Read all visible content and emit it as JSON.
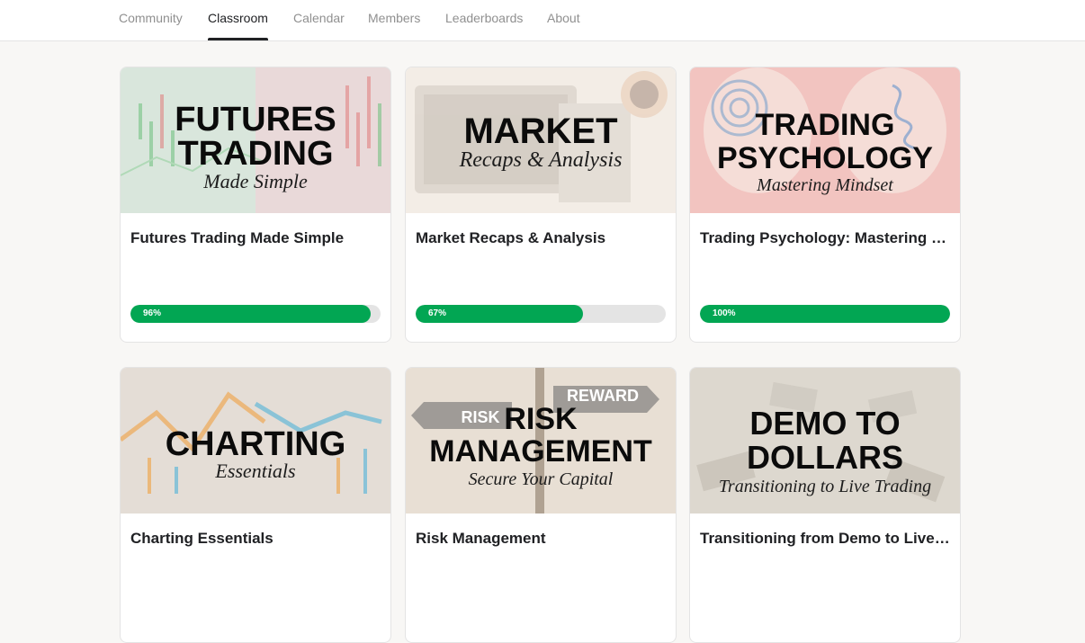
{
  "nav": {
    "tabs": [
      {
        "label": "Community"
      },
      {
        "label": "Classroom"
      },
      {
        "label": "Calendar"
      },
      {
        "label": "Members"
      },
      {
        "label": "Leaderboards"
      },
      {
        "label": "About"
      }
    ],
    "active": "Classroom"
  },
  "courses": [
    {
      "title": "Futures Trading Made Simple",
      "progress": 96,
      "progress_label": "96%",
      "cover": {
        "line1": "FUTURES",
        "line2": "TRADING",
        "script": "Made Simple"
      }
    },
    {
      "title": "Market Recaps & Analysis",
      "progress": 67,
      "progress_label": "67%",
      "cover": {
        "line1": "MARKET",
        "script": "Recaps & Analysis"
      }
    },
    {
      "title": "Trading Psychology: Mastering M...",
      "progress": 100,
      "progress_label": "100%",
      "cover": {
        "line1": "TRADING",
        "line2": "PSYCHOLOGY",
        "script": "Mastering Mindset"
      }
    },
    {
      "title": "Charting Essentials",
      "cover": {
        "line1": "CHARTING",
        "script": "Essentials"
      }
    },
    {
      "title": "Risk Management",
      "cover": {
        "line1": "RISK",
        "line2": "MANAGEMENT",
        "script": "Secure Your Capital",
        "sign_left": "RISK",
        "sign_right": "REWARD"
      }
    },
    {
      "title": "Transitioning from Demo to Live T...",
      "cover": {
        "line1": "DEMO TO",
        "line2": "DOLLARS",
        "script": "Transitioning to Live Trading"
      }
    }
  ],
  "colors": {
    "progress": "#02a653",
    "track": "#e4e4e4",
    "background": "#f8f7f5"
  }
}
